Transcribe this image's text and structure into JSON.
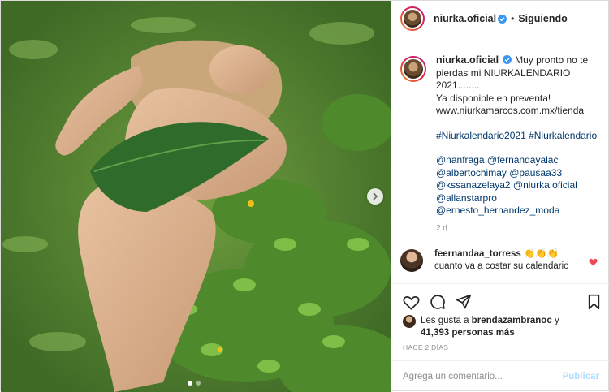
{
  "post": {
    "author": "niurka.oficial",
    "follow_status": "Siguiendo",
    "follow_separator": "•",
    "carousel": {
      "dot_count": 2,
      "active_index": 0
    }
  },
  "caption": {
    "username": "niurka.oficial",
    "lines": [
      "Muy pronto no te",
      "pierdas mi NIURKALENDARIO",
      "2021........",
      "Ya disponible en preventa!",
      "www.niurkamarcos.com.mx/tienda"
    ],
    "hashtags": "#Niurkalendario2021 #Niurkalendario",
    "mentions": [
      "@nanfraga @fernandayalac",
      "@albertochimay @pausaa33",
      "@kssanazelaya2 @niurka.oficial",
      "@allanstarpro",
      "@ernesto_hernandez_moda"
    ],
    "time": "2 d"
  },
  "comment": {
    "username": "feernandaa_torress",
    "emojis": "👏👏👏",
    "text": "cuanto va a costar su calendario"
  },
  "likes": {
    "prefix": "Les gusta a",
    "user": "brendazambranoc",
    "connector": "y",
    "count": "41,393 personas más"
  },
  "timestamp": "HACE 2 DÍAS",
  "composer": {
    "placeholder": "Agrega un comentario...",
    "publish": "Publicar"
  },
  "colors": {
    "verified": "#3897f0",
    "link": "#00376b",
    "muted": "#8e8e8e",
    "publish_disabled": "#b2dffc",
    "heart": "#ed4956"
  }
}
